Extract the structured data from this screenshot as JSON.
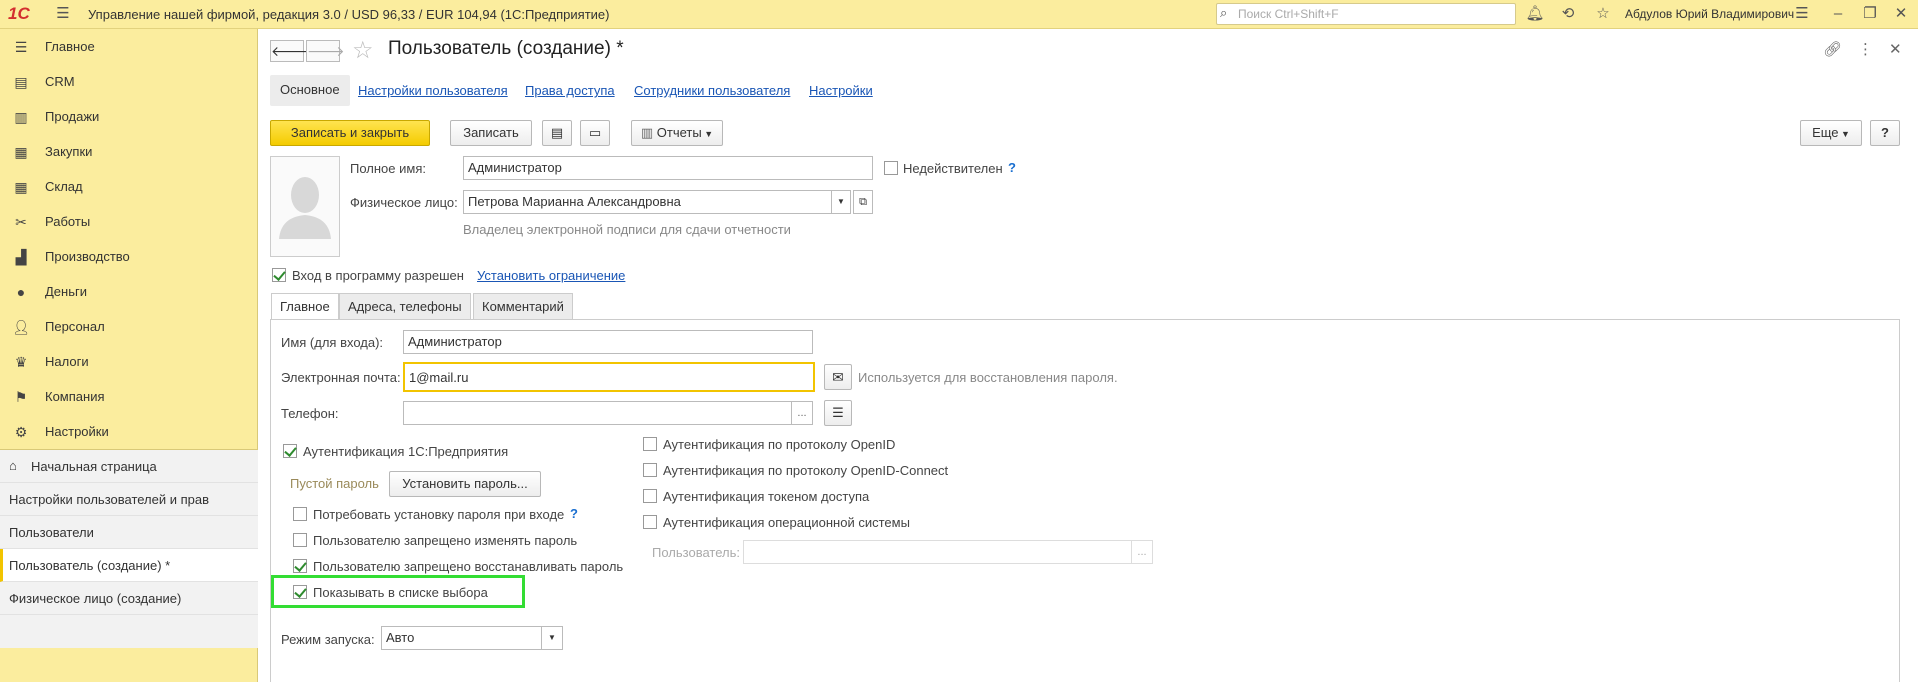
{
  "app": {
    "title": "Управление нашей фирмой, редакция 3.0 / USD 96,33 / EUR 104,94  (1С:Предприятие)",
    "logo": "1С",
    "search_placeholder": "Поиск Ctrl+Shift+F",
    "user": "Абдулов Юрий Владимирович"
  },
  "sidebar": {
    "items": [
      {
        "label": "Главное",
        "icon": "menu-icon"
      },
      {
        "label": "CRM",
        "icon": "crm-icon"
      },
      {
        "label": "Продажи",
        "icon": "sales-icon"
      },
      {
        "label": "Закупки",
        "icon": "purchases-icon"
      },
      {
        "label": "Склад",
        "icon": "warehouse-icon"
      },
      {
        "label": "Работы",
        "icon": "tools-icon"
      },
      {
        "label": "Производство",
        "icon": "factory-icon"
      },
      {
        "label": "Деньги",
        "icon": "money-icon"
      },
      {
        "label": "Персонал",
        "icon": "staff-icon"
      },
      {
        "label": "Налоги",
        "icon": "taxes-icon"
      },
      {
        "label": "Компания",
        "icon": "flag-icon"
      },
      {
        "label": "Настройки",
        "icon": "gear-icon"
      }
    ],
    "open_windows": [
      {
        "label": "Начальная страница"
      },
      {
        "label": "Настройки пользователей и прав"
      },
      {
        "label": "Пользователи"
      },
      {
        "label": "Пользователь (создание) *"
      },
      {
        "label": "Физическое лицо (создание)"
      }
    ]
  },
  "form": {
    "title": "Пользователь (создание) *",
    "tabs": [
      "Основное",
      "Настройки пользователя",
      "Права доступа",
      "Сотрудники пользователя",
      "Настройки"
    ],
    "toolbar": {
      "save_close": "Записать и закрыть",
      "save": "Записать",
      "reports": "Отчеты",
      "more": "Еще",
      "help": "?"
    },
    "full_name_label": "Полное имя:",
    "full_name_value": "Администратор",
    "invalid_label": "Недействителен",
    "person_label": "Физическое лицо:",
    "person_value": "Петрова Марианна Александровна",
    "person_hint": "Владелец электронной подписи для сдачи отчетности",
    "login_allowed": "Вход в программу разрешен",
    "set_restriction": "Установить ограничение",
    "subtabs": [
      "Главное",
      "Адреса, телефоны",
      "Комментарий"
    ],
    "login_name_label": "Имя (для входа):",
    "login_name_value": "Администратор",
    "email_label": "Электронная почта:",
    "email_value": "1@mail.ru",
    "email_hint": "Используется для восстановления пароля.",
    "phone_label": "Телефон:",
    "phone_value": "",
    "auth_1c": "Аутентификация 1С:Предприятия",
    "empty_password": "Пустой пароль",
    "set_password": "Установить пароль...",
    "require_password": "Потребовать установку пароля при входе",
    "deny_change_password": "Пользователю запрещено изменять пароль",
    "deny_restore_password": "Пользователю запрещено восстанавливать пароль",
    "show_in_list": "Показывать в списке выбора",
    "auth_openid": "Аутентификация по протоколу OpenID",
    "auth_openid_connect": "Аутентификация по протоколу OpenID-Connect",
    "auth_token": "Аутентификация токеном доступа",
    "auth_os": "Аутентификация операционной системы",
    "os_user_label": "Пользователь:",
    "os_user_value": "",
    "launch_mode_label": "Режим запуска:",
    "launch_mode_value": "Авто"
  },
  "colors": {
    "topbar": "#fbed9e",
    "primary_button": "#f4cc00",
    "highlight": "#33dd33",
    "link": "#1a56b5"
  }
}
